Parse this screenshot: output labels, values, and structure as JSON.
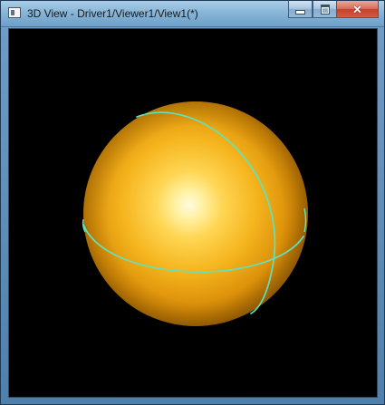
{
  "window": {
    "title": "3D View - Driver1/Viewer1/View1(*)",
    "icon": "app-window-icon",
    "controls": {
      "minimize_icon": "minimize-icon",
      "maximize_icon": "maximize-icon",
      "close_icon": "close-icon",
      "close_glyph": "✕"
    }
  },
  "viewport": {
    "background_color": "#000000",
    "object": {
      "shape": "sphere",
      "color": "#f2b21f",
      "highlight_color": "#fff6b0",
      "edge_color": "#58e1b8"
    }
  }
}
